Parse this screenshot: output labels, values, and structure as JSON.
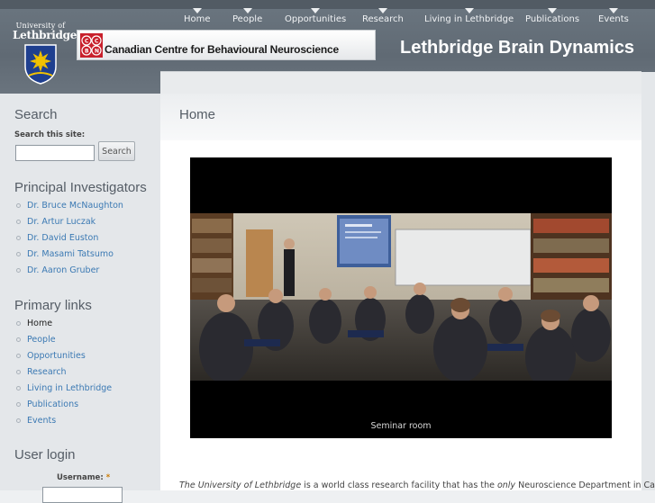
{
  "header": {
    "logo": {
      "line1": "University of",
      "line2": "Lethbridge"
    },
    "banner": {
      "logo_text": "CCBN",
      "text": "Canadian Centre for Behavioural Neuroscience"
    },
    "site_title": "Lethbridge Brain Dynamics"
  },
  "nav": {
    "items": [
      {
        "label": "Home"
      },
      {
        "label": "People"
      },
      {
        "label": "Opportunities"
      },
      {
        "label": "Research"
      },
      {
        "label": "Living in Lethbridge"
      },
      {
        "label": "Publications"
      },
      {
        "label": "Events"
      }
    ]
  },
  "sidebar": {
    "search": {
      "title": "Search",
      "label": "Search this site:",
      "input_value": "",
      "button": "Search"
    },
    "investigators": {
      "title": "Principal Investigators",
      "items": [
        {
          "label": "Dr. Bruce McNaughton"
        },
        {
          "label": "Dr. Artur Luczak"
        },
        {
          "label": "Dr. David Euston"
        },
        {
          "label": "Dr. Masami Tatsumo"
        },
        {
          "label": "Dr. Aaron Gruber"
        }
      ]
    },
    "primary_links": {
      "title": "Primary links",
      "active": "Home",
      "items": [
        {
          "label": "Home"
        },
        {
          "label": "People"
        },
        {
          "label": "Opportunities"
        },
        {
          "label": "Research"
        },
        {
          "label": "Living in Lethbridge"
        },
        {
          "label": "Publications"
        },
        {
          "label": "Events"
        }
      ]
    },
    "login": {
      "title": "User login",
      "username_label": "Username:",
      "required_mark": "*",
      "username_value": ""
    }
  },
  "main": {
    "title": "Home",
    "slideshow": {
      "caption": "Seminar room"
    },
    "intro": {
      "part1": "The University of Lethbridge",
      "part2": " is a world class research facility that has the ",
      "part3": "only",
      "part4": " Neuroscience Department in Canada,"
    }
  },
  "colors": {
    "header_bg": "#646e78",
    "link": "#3b79b3",
    "sidebar_bg": "#e4e7ea",
    "content_bg": "#ffffff",
    "shield_blue": "#1f3f8f",
    "shield_gold": "#f2c200",
    "ccbn_red": "#c8202b"
  }
}
